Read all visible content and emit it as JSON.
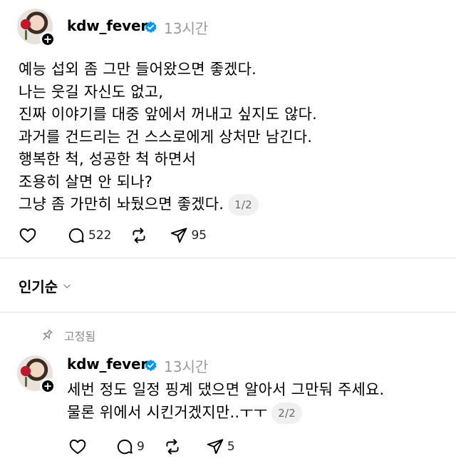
{
  "post": {
    "username": "kdw_fever",
    "time": "13시간",
    "lines": [
      "예능 섭외 좀 그만 들어왔으면 좋겠다.",
      "나는 웃길 자신도 없고,",
      "진짜 이야기를 대중 앞에서 꺼내고 싶지도 않다.",
      "과거를 건드리는 건 스스로에게 상처만 남긴다.",
      "행복한 척, 성공한 척 하면서",
      "조용히 살면 안 되나?",
      "그냥 좀 가만히 놔뒀으면 좋겠다."
    ],
    "page": "1/2",
    "comments": "522",
    "shares": "95"
  },
  "sort": {
    "label": "인기순"
  },
  "reply": {
    "pinned_label": "고정됨",
    "username": "kdw_fever",
    "time": "13시간",
    "lines": [
      "세번 정도 일정 핑계 댔으면 알아서 그만둬 주세요.",
      "물론 위에서 시킨거겠지만..ㅜㅜ"
    ],
    "page": "2/2",
    "comments": "9",
    "shares": "5"
  },
  "colors": {
    "verified": "#0095f6",
    "muted": "#9a9a9a",
    "divider": "#e2e2e2"
  },
  "icons": [
    "heart-icon",
    "comment-icon",
    "repost-icon",
    "share-icon",
    "pin-icon",
    "verified-icon",
    "chevron-down-icon",
    "follow-plus-icon"
  ]
}
